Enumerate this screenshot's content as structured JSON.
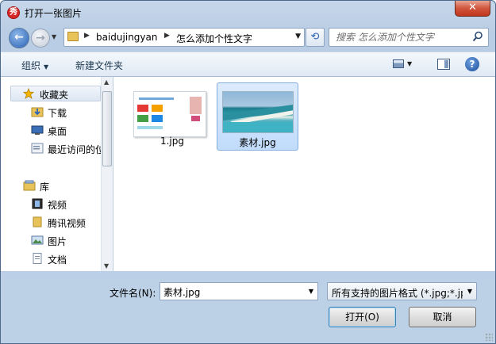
{
  "window": {
    "title": "打开一张图片",
    "app_icon_glyph": "秀",
    "close_glyph": "✕"
  },
  "nav": {
    "back_glyph": "←",
    "forward_glyph": "→",
    "refresh_glyph": "⟲",
    "breadcrumbs": [
      "baidujingyan",
      "怎么添加个性文字"
    ]
  },
  "search": {
    "placeholder": "搜索 怎么添加个性文字",
    "icon": "search-icon"
  },
  "toolbar": {
    "organize_label": "组织",
    "new_folder_label": "新建文件夹",
    "help_glyph": "?"
  },
  "sidebar": {
    "items": [
      {
        "label": "收藏夹",
        "icon": "star-icon"
      },
      {
        "label": "下载",
        "icon": "download-folder-icon"
      },
      {
        "label": "桌面",
        "icon": "desktop-icon"
      },
      {
        "label": "最近访问的位置",
        "icon": "recent-places-icon"
      },
      {
        "label": "库",
        "icon": "library-icon"
      },
      {
        "label": "视频",
        "icon": "video-icon"
      },
      {
        "label": "腾讯视频",
        "icon": "folder-icon"
      },
      {
        "label": "图片",
        "icon": "pictures-icon"
      },
      {
        "label": "文档",
        "icon": "documents-icon"
      }
    ]
  },
  "files": [
    {
      "name": "1.jpg",
      "selected": false
    },
    {
      "name": "素材.jpg",
      "selected": true
    }
  ],
  "footer": {
    "filename_label": "文件名(N):",
    "filename_value": "素材.jpg",
    "filter_value": "所有支持的图片格式 (*.jpg;*.jp",
    "open_label": "打开(O)",
    "cancel_label": "取消"
  },
  "colors": {
    "accent": "#2a62b5",
    "selection": "#c1dcfc",
    "close": "#c1361c"
  }
}
